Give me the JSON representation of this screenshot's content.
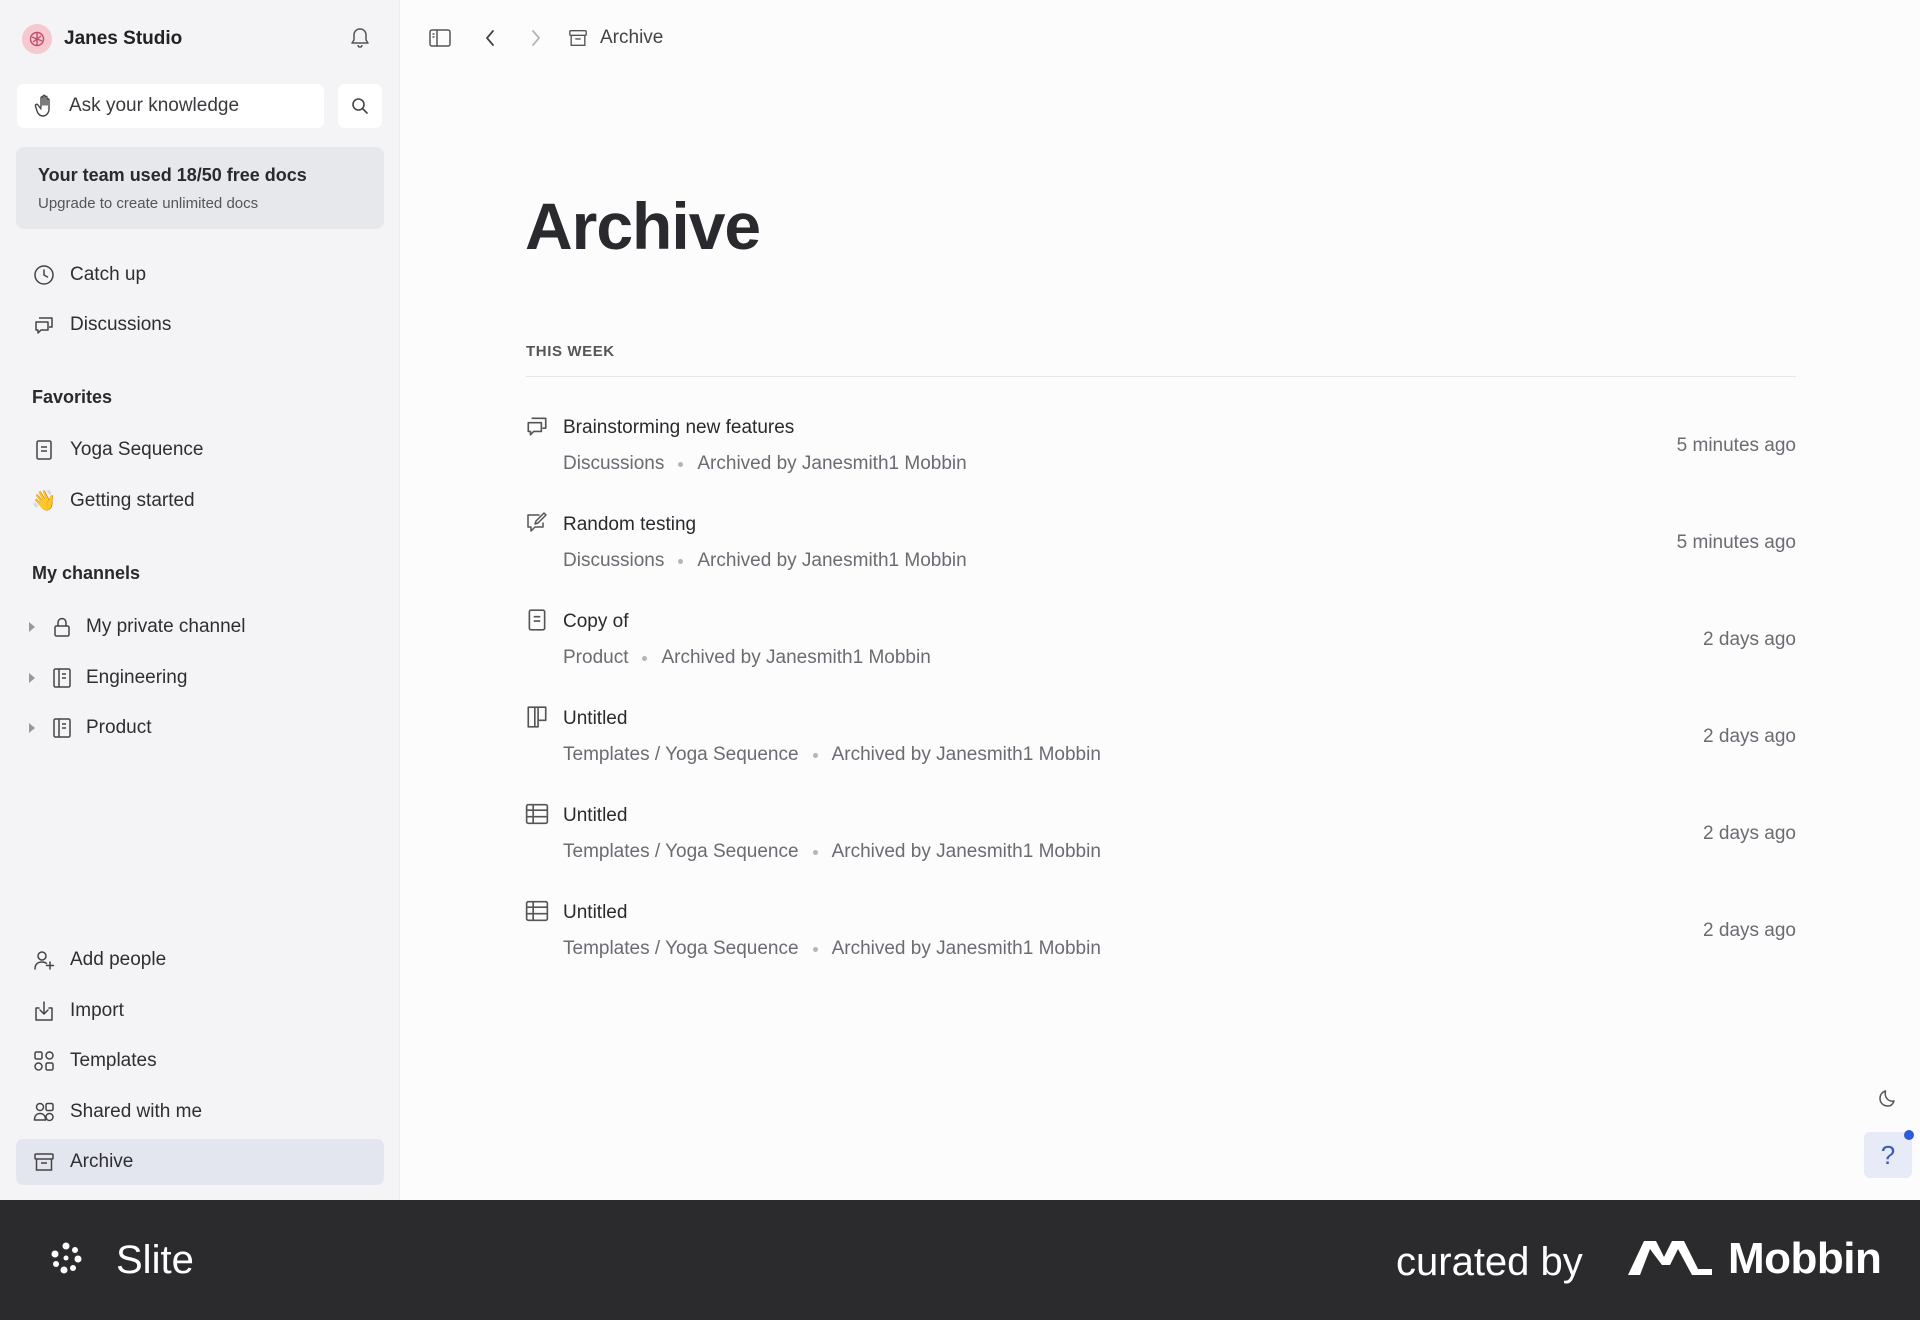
{
  "workspace": {
    "name": "Janes Studio"
  },
  "search": {
    "placeholder": "Ask your knowledge"
  },
  "upgrade": {
    "title": "Your team used 18/50 free docs",
    "subtitle": "Upgrade to create unlimited docs"
  },
  "nav_top": [
    {
      "label": "Catch up",
      "icon": "clock-icon"
    },
    {
      "label": "Discussions",
      "icon": "chat-bubbles-icon"
    }
  ],
  "favorites": {
    "heading": "Favorites",
    "items": [
      {
        "label": "Yoga Sequence",
        "icon": "document-icon"
      },
      {
        "label": "Getting started",
        "icon": "waving-hand-emoji",
        "emoji": "👋"
      }
    ]
  },
  "channels": {
    "heading": "My channels",
    "items": [
      {
        "label": "My private channel",
        "icon": "lock-icon"
      },
      {
        "label": "Engineering",
        "icon": "channel-icon"
      },
      {
        "label": "Product",
        "icon": "channel-icon"
      }
    ]
  },
  "nav_bottom": [
    {
      "label": "Add people",
      "icon": "add-person-icon"
    },
    {
      "label": "Import",
      "icon": "import-icon"
    },
    {
      "label": "Templates",
      "icon": "templates-icon"
    },
    {
      "label": "Shared with me",
      "icon": "shared-icon"
    },
    {
      "label": "Archive",
      "icon": "archive-icon",
      "active": true
    }
  ],
  "breadcrumb": {
    "label": "Archive"
  },
  "page": {
    "title": "Archive",
    "group_heading": "THIS WEEK",
    "items": [
      {
        "title": "Brainstorming new features",
        "location": "Discussions",
        "archived_by": "Archived by Janesmith1 Mobbin",
        "time": "5 minutes ago",
        "icon": "chat-bubbles-icon"
      },
      {
        "title": "Random testing",
        "location": "Discussions",
        "archived_by": "Archived by Janesmith1 Mobbin",
        "time": "5 minutes ago",
        "icon": "edit-bubble-icon"
      },
      {
        "title": "Copy of",
        "location": "Product",
        "archived_by": "Archived by Janesmith1 Mobbin",
        "time": "2 days ago",
        "icon": "document-icon"
      },
      {
        "title": "Untitled",
        "location": "Templates / Yoga Sequence",
        "archived_by": "Archived by Janesmith1 Mobbin",
        "time": "2 days ago",
        "icon": "board-icon"
      },
      {
        "title": "Untitled",
        "location": "Templates / Yoga Sequence",
        "archived_by": "Archived by Janesmith1 Mobbin",
        "time": "2 days ago",
        "icon": "table-icon"
      },
      {
        "title": "Untitled",
        "location": "Templates / Yoga Sequence",
        "archived_by": "Archived by Janesmith1 Mobbin",
        "time": "2 days ago",
        "icon": "table-icon"
      }
    ]
  },
  "help": {
    "label": "?"
  },
  "footer": {
    "brand": "Slite",
    "curated": "curated by",
    "mobbin": "Mobbin"
  },
  "colors": {
    "sidebar_bg": "#f4f4f6",
    "active_bg": "#e4e6ef",
    "footer_bg": "#2b2b2d",
    "accent": "#2d5bd9"
  }
}
